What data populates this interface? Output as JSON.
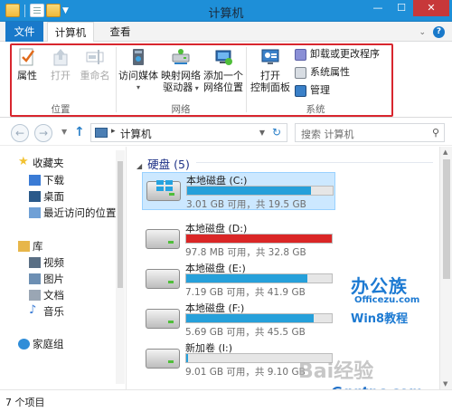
{
  "window": {
    "title": "计算机"
  },
  "title_controls": {
    "minimize": "—",
    "maximize": "☐",
    "close": "✕"
  },
  "tabs": [
    {
      "label": "文件"
    },
    {
      "label": "计算机"
    },
    {
      "label": "查看"
    }
  ],
  "ribbon": {
    "location_group": {
      "label": "位置",
      "buttons": [
        {
          "label": "属性",
          "enabled": true,
          "icon": "checkmark-properties-icon"
        },
        {
          "label": "打开",
          "enabled": false,
          "icon": "open-arrow-icon"
        },
        {
          "label": "重命名",
          "enabled": false,
          "icon": "rename-icon"
        }
      ]
    },
    "network_group": {
      "label": "网络",
      "buttons": [
        {
          "label": "访问媒体",
          "icon": "media-server-icon",
          "has_dropdown": true
        },
        {
          "label": "映射网络",
          "label2": "驱动器",
          "icon": "map-network-drive-icon",
          "has_dropdown": true
        },
        {
          "label": "添加一个",
          "label2": "网络位置",
          "icon": "network-location-icon"
        }
      ]
    },
    "system_group": {
      "label": "系统",
      "big_button": {
        "label": "打开",
        "label2": "控制面板",
        "icon": "control-panel-icon"
      },
      "small_buttons": [
        {
          "label": "卸载或更改程序",
          "icon": "uninstall-icon"
        },
        {
          "label": "系统属性",
          "icon": "system-properties-icon"
        },
        {
          "label": "管理",
          "icon": "manage-icon"
        }
      ]
    }
  },
  "address": {
    "path": "计算机",
    "search_placeholder": "搜索 计算机"
  },
  "nav_pane": {
    "items": [
      {
        "label": "收藏夹",
        "icon": "star-icon",
        "color": "#f2c232"
      },
      {
        "label": "下载",
        "icon": "download-folder-icon",
        "color": "#3a7bd5"
      },
      {
        "label": "桌面",
        "icon": "desktop-icon",
        "color": "#2b5a8a"
      },
      {
        "label": "最近访问的位置",
        "icon": "recent-places-icon",
        "color": "#6fa0d6"
      },
      {
        "label": "库",
        "icon": "libraries-icon",
        "color": "#e7b64a"
      },
      {
        "label": "视频",
        "icon": "videos-icon",
        "color": "#5a6f85"
      },
      {
        "label": "图片",
        "icon": "pictures-icon",
        "color": "#6d8fb3"
      },
      {
        "label": "文档",
        "icon": "documents-icon",
        "color": "#9aa6b4"
      },
      {
        "label": "音乐",
        "icon": "music-icon",
        "color": "#3a7bd5"
      },
      {
        "label": "家庭组",
        "icon": "homegroup-icon",
        "color": "#2f8dd8"
      }
    ]
  },
  "drives_group": {
    "header": "硬盘 (5)",
    "drives": [
      {
        "name": "本地磁盘 (C:)",
        "free_text": "3.01 GB 可用，共 19.5 GB",
        "used_fraction": 0.85,
        "fill_color": "#26a0da",
        "is_system": true,
        "selected": true
      },
      {
        "name": "本地磁盘 (D:)",
        "free_text": "97.8 MB 可用，共 32.8 GB",
        "used_fraction": 0.997,
        "fill_color": "#da2626",
        "is_system": false
      },
      {
        "name": "本地磁盘 (E:)",
        "free_text": "7.19 GB 可用，共 41.9 GB",
        "used_fraction": 0.83,
        "fill_color": "#26a0da",
        "is_system": false
      },
      {
        "name": "本地磁盘 (F:)",
        "free_text": "5.69 GB 可用，共 45.5 GB",
        "used_fraction": 0.875,
        "fill_color": "#26a0da",
        "is_system": false
      },
      {
        "name": "新加卷 (I:)",
        "free_text": "9.01 GB 可用，共 9.10 GB",
        "used_fraction": 0.01,
        "fill_color": "#26a0da",
        "is_system": false
      }
    ]
  },
  "status": {
    "item_count": "7 个项目"
  },
  "watermarks": {
    "logo_cn": "办公族",
    "logo_en": "Officezu.com",
    "logo_w8": "Win8教程",
    "baidu": "Bai经验",
    "site": "Gqgtpc.com"
  }
}
